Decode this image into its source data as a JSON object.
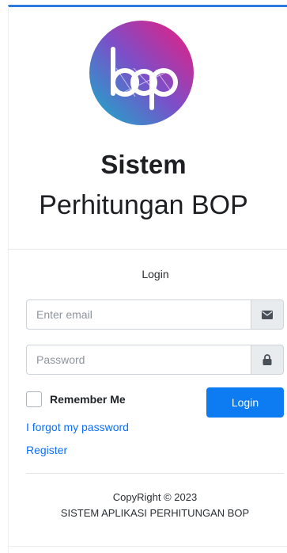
{
  "brand": {
    "logo_text": "bop",
    "title_line1": "Sistem",
    "title_line2": "Perhitungan BOP",
    "accent_color": "#2d7be0",
    "logo_gradient": [
      "#ee1b7c",
      "#7b4fc9",
      "#14b1c9"
    ]
  },
  "login": {
    "heading": "Login",
    "email_placeholder": "Enter email",
    "email_icon": "envelope-icon",
    "password_placeholder": "Password",
    "password_icon": "lock-icon",
    "remember_label": "Remember Me",
    "remember_checked": false,
    "submit_label": "Login",
    "button_color": "#0d7bf1",
    "forgot_link": "I forgot my password",
    "register_link": "Register"
  },
  "footer": {
    "copyright": "CopyRight © 2023",
    "app_name": "SISTEM APLIKASI PERHITUNGAN BOP"
  }
}
